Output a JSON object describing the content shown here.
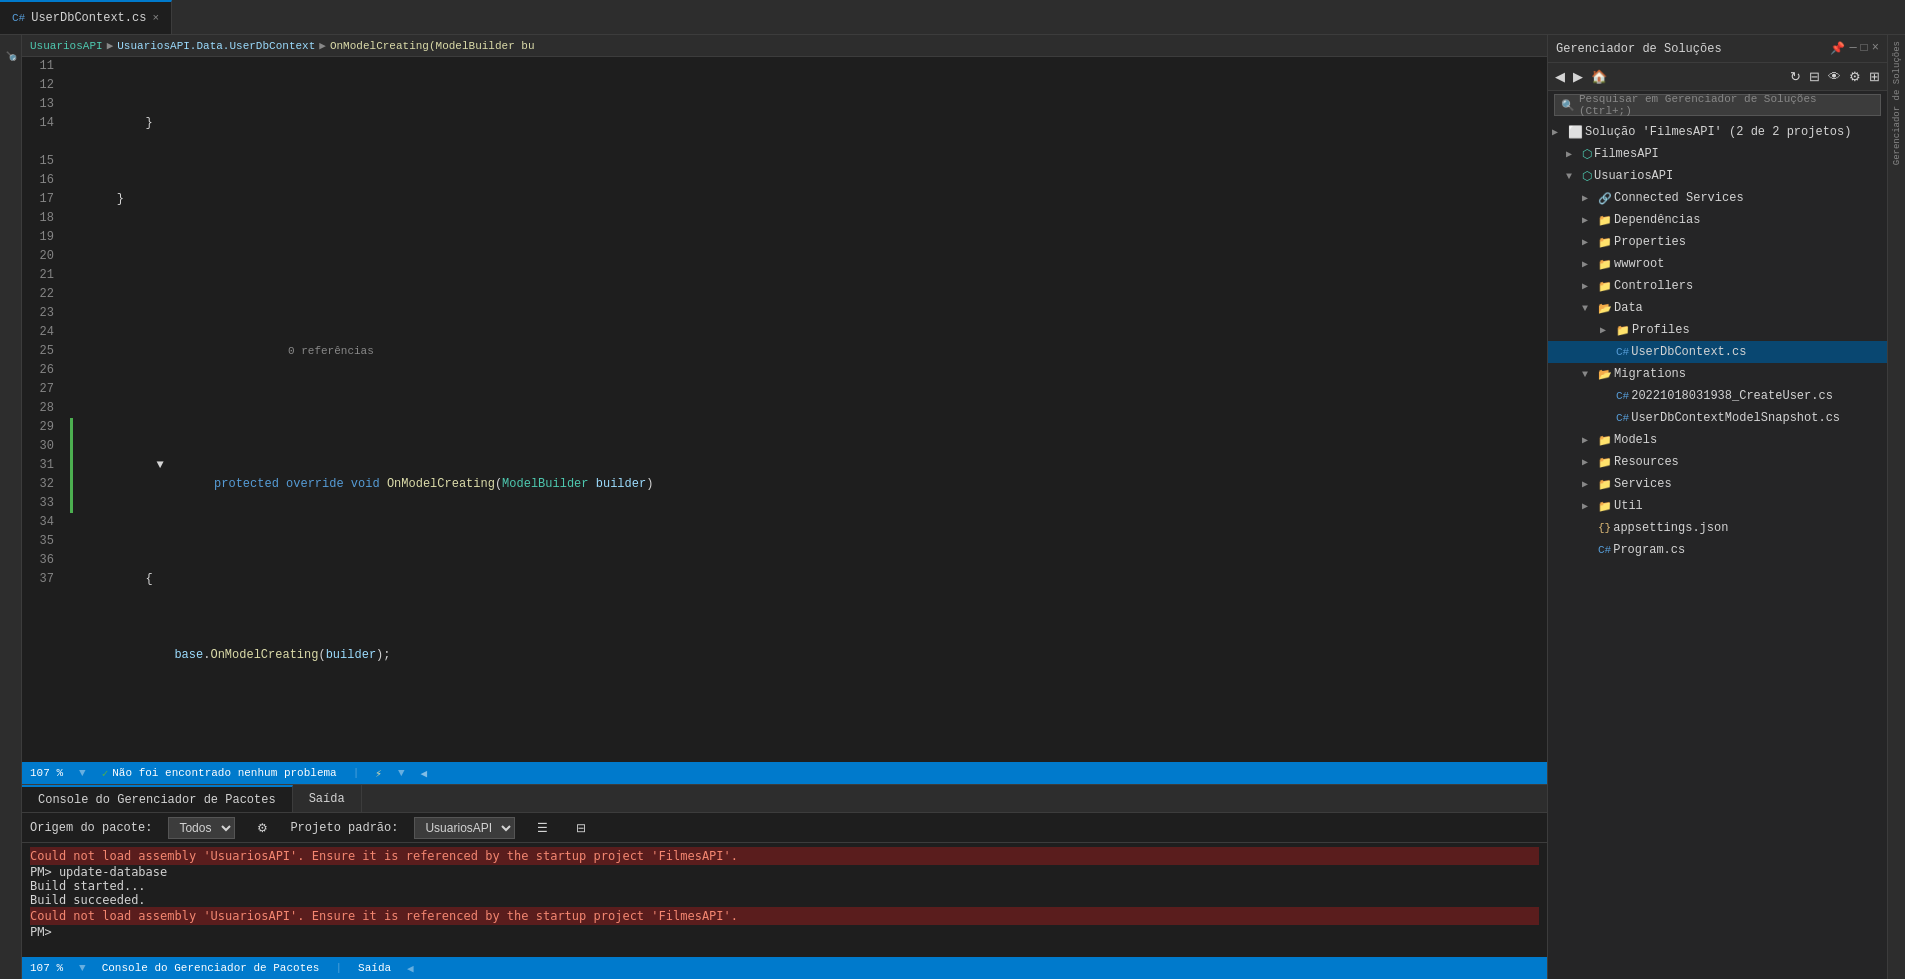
{
  "tab": {
    "filename": "UserDbContext.cs",
    "close_icon": "×"
  },
  "breadcrumb": {
    "project": "UsuariosAPI",
    "namespace": "UsuariosAPI.Data.UserDbContext",
    "method": "OnModelCreating(ModelBuilder bu"
  },
  "code": {
    "lines": [
      {
        "num": 11,
        "gutter": "",
        "content": "        }"
      },
      {
        "num": 12,
        "gutter": "",
        "content": "    }"
      },
      {
        "num": 13,
        "gutter": "",
        "content": ""
      },
      {
        "num": 14,
        "gutter": "ref",
        "content_key": "line14",
        "has_green_bar": true,
        "ref_text": "0 referências"
      },
      {
        "num": 15,
        "gutter": "",
        "content_key": "line15"
      },
      {
        "num": 16,
        "gutter": "",
        "content_key": "line16"
      },
      {
        "num": 17,
        "gutter": "",
        "content": ""
      },
      {
        "num": 18,
        "gutter": "collapse",
        "content_key": "line18"
      },
      {
        "num": 19,
        "gutter": "warn",
        "content": "        {"
      },
      {
        "num": 20,
        "gutter": "",
        "content_key": "line20"
      },
      {
        "num": 21,
        "gutter": "",
        "content_key": "line21"
      },
      {
        "num": 22,
        "gutter": "",
        "content_key": "line22"
      },
      {
        "num": 23,
        "gutter": "",
        "content_key": "line23"
      },
      {
        "num": 24,
        "gutter": "",
        "content_key": "line24"
      },
      {
        "num": 25,
        "gutter": "",
        "content_key": "line25"
      },
      {
        "num": 26,
        "gutter": "",
        "content_key": "line26"
      },
      {
        "num": 27,
        "gutter": "",
        "content_key": "line27"
      },
      {
        "num": 28,
        "gutter": "",
        "content": ""
      },
      {
        "num": 29,
        "gutter": "",
        "content_key": "line29"
      },
      {
        "num": 30,
        "gutter": "",
        "content": ""
      },
      {
        "num": 31,
        "gutter": "",
        "content_key": "line31"
      },
      {
        "num": 32,
        "gutter": "",
        "content": ""
      },
      {
        "num": 33,
        "gutter": "",
        "content_key": "line33"
      },
      {
        "num": 34,
        "gutter": "",
        "content": ""
      },
      {
        "num": 35,
        "gutter": "collapse",
        "content_key": "line35"
      },
      {
        "num": 36,
        "gutter": "",
        "content": "        {"
      },
      {
        "num": 37,
        "gutter": "",
        "content_key": "line37"
      }
    ]
  },
  "status_bar": {
    "zoom": "107 %",
    "no_problems": "Não foi encontrado nenhum problema"
  },
  "bottom_panel": {
    "tabs": [
      "Console do Gerenciador de Pacotes",
      "Saída"
    ],
    "active_tab": "Console do Gerenciador de Pacotes",
    "origin_label": "Origem do pacote:",
    "origin_value": "Todos",
    "project_label": "Projeto padrão:",
    "project_value": "UsuariosAPI",
    "console_lines": [
      {
        "type": "error",
        "text": "Could not load assembly 'UsuariosAPI'. Ensure it is referenced by the startup project 'FilmesAPI'."
      },
      {
        "type": "normal",
        "text": "PM> update-database"
      },
      {
        "type": "normal",
        "text": "Build started..."
      },
      {
        "type": "normal",
        "text": "Build succeeded."
      },
      {
        "type": "error",
        "text": "Could not load assembly 'UsuariosAPI'. Ensure it is referenced by the startup project 'FilmesAPI'."
      },
      {
        "type": "normal",
        "text": "PM> "
      }
    ]
  },
  "solution_explorer": {
    "title": "Gerenciador de Soluções",
    "search_placeholder": "Pesquisar em Gerenciador de Soluções (Ctrl+;)",
    "solution_label": "Solução 'FilmesAPI' (2 de 2 projetos)",
    "items": [
      {
        "id": "solution",
        "label": "Solução 'FilmesAPI' (2 de 2 projetos)",
        "indent": 0,
        "type": "solution",
        "arrow": "▶",
        "expanded": true
      },
      {
        "id": "filmesapi",
        "label": "FilmesAPI",
        "indent": 1,
        "type": "project",
        "arrow": "▶",
        "expanded": false
      },
      {
        "id": "usuariosapi",
        "label": "UsuariosAPI",
        "indent": 1,
        "type": "project",
        "arrow": "▼",
        "expanded": true
      },
      {
        "id": "connected-services",
        "label": "Connected Services",
        "indent": 2,
        "type": "service",
        "arrow": "▶"
      },
      {
        "id": "dependencias",
        "label": "Dependências",
        "indent": 2,
        "type": "folder",
        "arrow": "▶"
      },
      {
        "id": "properties",
        "label": "Properties",
        "indent": 2,
        "type": "folder",
        "arrow": "▶"
      },
      {
        "id": "wwwroot",
        "label": "wwwroot",
        "indent": 2,
        "type": "folder",
        "arrow": "▶"
      },
      {
        "id": "controllers",
        "label": "Controllers",
        "indent": 2,
        "type": "folder",
        "arrow": "▶"
      },
      {
        "id": "data",
        "label": "Data",
        "indent": 2,
        "type": "folder",
        "arrow": "▼",
        "expanded": true
      },
      {
        "id": "profiles",
        "label": "Profiles",
        "indent": 3,
        "type": "folder",
        "arrow": "▶"
      },
      {
        "id": "userdbcontext",
        "label": "UserDbContext.cs",
        "indent": 3,
        "type": "cs",
        "arrow": ""
      },
      {
        "id": "migrations",
        "label": "Migrations",
        "indent": 2,
        "type": "folder",
        "arrow": "▼",
        "expanded": true
      },
      {
        "id": "migration1",
        "label": "20221018031938_CreateUser.cs",
        "indent": 3,
        "type": "cs",
        "arrow": ""
      },
      {
        "id": "migration2",
        "label": "UserDbContextModelSnapshot.cs",
        "indent": 3,
        "type": "cs",
        "arrow": ""
      },
      {
        "id": "models",
        "label": "Models",
        "indent": 2,
        "type": "folder",
        "arrow": "▶"
      },
      {
        "id": "resources",
        "label": "Resources",
        "indent": 2,
        "type": "folder",
        "arrow": "▶"
      },
      {
        "id": "services",
        "label": "Services",
        "indent": 2,
        "type": "folder",
        "arrow": "▶"
      },
      {
        "id": "util",
        "label": "Util",
        "indent": 2,
        "type": "folder",
        "arrow": "▶"
      },
      {
        "id": "appsettings",
        "label": "appsettings.json",
        "indent": 2,
        "type": "json",
        "arrow": ""
      },
      {
        "id": "programcs",
        "label": "Program.cs",
        "indent": 2,
        "type": "cs",
        "arrow": ""
      }
    ]
  },
  "bottom_status": {
    "zoom": "107 %",
    "tab_label": "Console do Gerenciador de Pacotes",
    "saida_label": "Saída"
  }
}
